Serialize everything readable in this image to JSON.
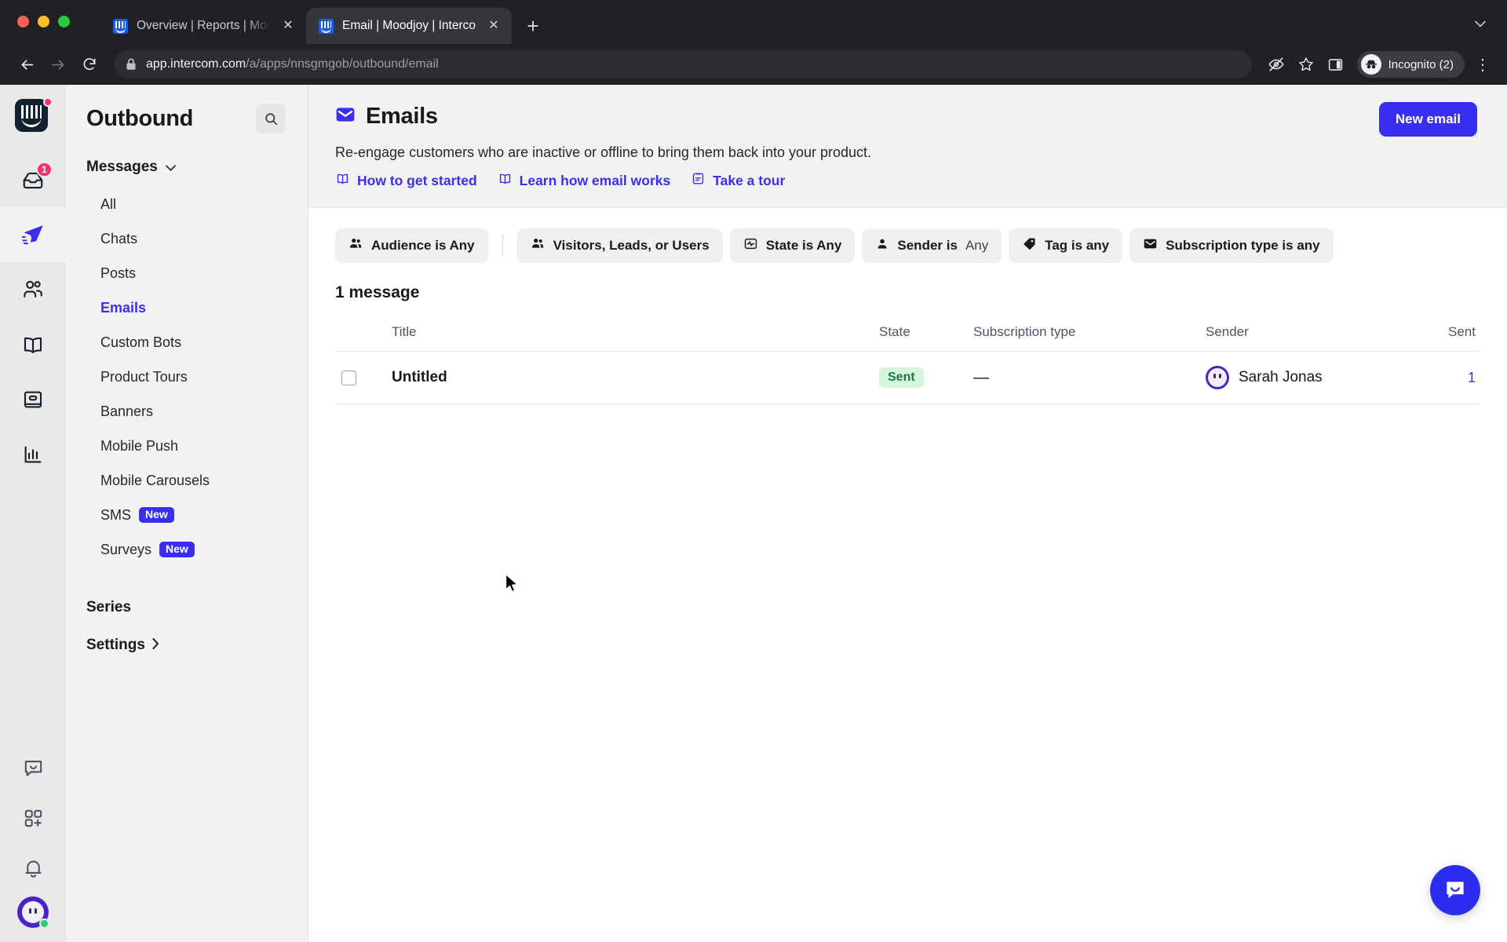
{
  "browser": {
    "tabs": [
      {
        "title": "Overview | Reports | Moodjoy |",
        "favicon": "intercom-favicon",
        "active": false,
        "close_label": "✕"
      },
      {
        "title": "Email | Moodjoy | Intercom",
        "favicon": "intercom-favicon",
        "active": true,
        "close_label": "✕"
      }
    ],
    "new_tab_label": "+",
    "tab_search_label": "⌄",
    "back_label": "←",
    "forward_label": "→",
    "reload_label": "⟳",
    "url_host": "app.intercom.com",
    "url_path": "/a/apps/nnsgmgob/outbound/email",
    "profile_label": "Incognito (2)",
    "menu_label": "⋮"
  },
  "rail": {
    "inbox_badge": "1",
    "items": [
      {
        "name": "inbox",
        "badge": "1",
        "active": false
      },
      {
        "name": "outbound",
        "badge": "",
        "active": true
      },
      {
        "name": "contacts",
        "badge": "",
        "active": false
      },
      {
        "name": "articles",
        "badge": "",
        "active": false
      },
      {
        "name": "knowledge",
        "badge": "",
        "active": false
      },
      {
        "name": "reports",
        "badge": "",
        "active": false
      }
    ],
    "bottom_items": [
      "messenger",
      "apps",
      "notifications",
      "profile"
    ]
  },
  "sidebar": {
    "title": "Outbound",
    "search_icon": "search-icon",
    "group": {
      "label": "Messages",
      "chevron": "⌄"
    },
    "items": [
      {
        "label": "All",
        "badge": "",
        "selected": false
      },
      {
        "label": "Chats",
        "badge": "",
        "selected": false
      },
      {
        "label": "Posts",
        "badge": "",
        "selected": false
      },
      {
        "label": "Emails",
        "badge": "",
        "selected": true
      },
      {
        "label": "Custom Bots",
        "badge": "",
        "selected": false
      },
      {
        "label": "Product Tours",
        "badge": "",
        "selected": false
      },
      {
        "label": "Banners",
        "badge": "",
        "selected": false
      },
      {
        "label": "Mobile Push",
        "badge": "",
        "selected": false
      },
      {
        "label": "Mobile Carousels",
        "badge": "",
        "selected": false
      },
      {
        "label": "SMS",
        "badge": "New",
        "selected": false
      },
      {
        "label": "Surveys",
        "badge": "New",
        "selected": false
      }
    ],
    "series_label": "Series",
    "settings_label": "Settings",
    "settings_chevron": "›"
  },
  "header": {
    "title": "Emails",
    "icon": "envelope-icon",
    "new_button": "New email",
    "description": "Re-engage customers who are inactive or offline to bring them back into your product.",
    "links": [
      {
        "label": "How to get started",
        "icon": "book-icon"
      },
      {
        "label": "Learn how email works",
        "icon": "book-icon"
      },
      {
        "label": "Take a tour",
        "icon": "clipboard-icon"
      }
    ]
  },
  "filters": [
    {
      "label": "Audience is Any",
      "value": "",
      "icon": "people-icon"
    },
    {
      "label": "Visitors, Leads, or Users",
      "value": "",
      "icon": "people-icon"
    },
    {
      "label": "State is Any",
      "value": "",
      "icon": "pulse-icon"
    },
    {
      "label": "Sender is",
      "value": "Any",
      "icon": "person-icon"
    },
    {
      "label": "Tag is any",
      "value": "",
      "icon": "tag-icon"
    },
    {
      "label": "Subscription type is any",
      "value": "",
      "icon": "envelope-icon"
    }
  ],
  "list": {
    "count_label": "1 message",
    "columns": {
      "title": "Title",
      "state": "State",
      "subscription": "Subscription type",
      "sender": "Sender",
      "sent": "Sent"
    },
    "rows": [
      {
        "title": "Untitled",
        "state": "Sent",
        "subscription": "—",
        "sender": "Sarah Jonas",
        "sent": "1",
        "checked": false
      }
    ]
  },
  "chat_launcher": {
    "icon": "messenger-icon"
  },
  "colors": {
    "accent": "#3a2ff0",
    "link": "#3b2ff2",
    "badge_sent_bg": "#d6f5de",
    "badge_sent_text": "#1d7a3f",
    "notification": "#f4316a"
  }
}
